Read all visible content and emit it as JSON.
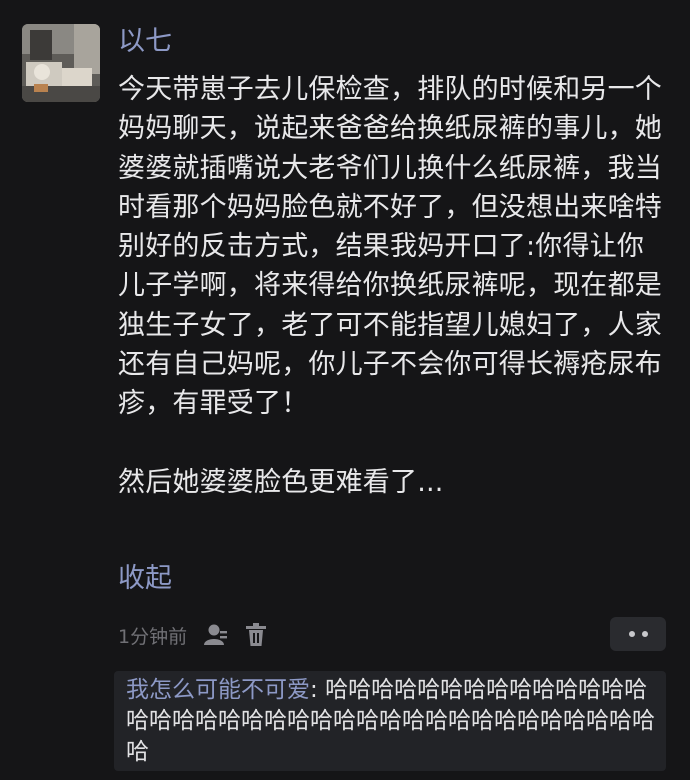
{
  "post": {
    "author": "以七",
    "content": "今天带崽子去儿保检查，排队的时候和另一个妈妈聊天，说起来爸爸给换纸尿裤的事儿，她婆婆就插嘴说大老爷们儿换什么纸尿裤，我当时看那个妈妈脸色就不好了，但没想出来啥特别好的反击方式，结果我妈开口了:你得让你儿子学啊，将来得给你换纸尿裤呢，现在都是独生子女了，老了可不能指望儿媳妇了，人家还有自己妈呢，你儿子不会你可得长褥疮尿布疹，有罪受了！\n\n然后她婆婆脸色更难看了...",
    "collapse_label": "收起",
    "timestamp": "1分钟前",
    "icons": {
      "user": "person-icon",
      "delete": "trash-icon",
      "more": "more-dots-icon"
    }
  },
  "reply": {
    "author": "我怎么可能不可爱",
    "separator": ": ",
    "text": "哈哈哈哈哈哈哈哈哈哈哈哈哈哈哈哈哈哈哈哈哈哈哈哈哈哈哈哈哈哈哈哈哈哈哈哈哈哈"
  },
  "colors": {
    "background": "#151517",
    "link": "#8d99c6",
    "text": "#e8e8ea",
    "muted": "#707075",
    "reply_bg": "#222327"
  }
}
